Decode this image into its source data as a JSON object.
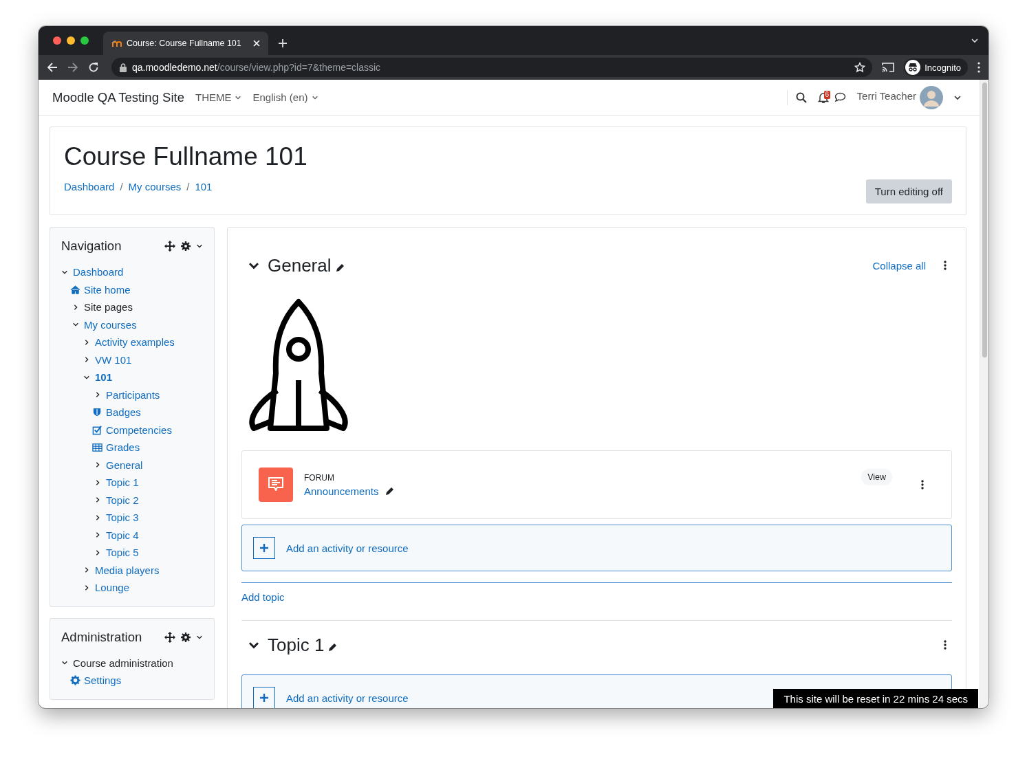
{
  "browser": {
    "tab_title": "Course: Course Fullname 101",
    "url_host": "qa.moodledemo.net",
    "url_path": "/course/view.php?id=7&theme=classic",
    "profile": "Incognito"
  },
  "navbar": {
    "site_name": "Moodle QA Testing Site",
    "menus": [
      "THEME",
      "English (en)"
    ],
    "notification_count": "6",
    "user_name": "Terri Teacher"
  },
  "header": {
    "title": "Course Fullname 101",
    "breadcrumbs": [
      {
        "label": "Dashboard",
        "kind": "link"
      },
      {
        "label": "/",
        "kind": "separator"
      },
      {
        "label": "My courses",
        "kind": "link"
      },
      {
        "label": "/",
        "kind": "separator"
      },
      {
        "label": "101",
        "kind": "link"
      }
    ],
    "edit_button": "Turn editing off"
  },
  "blocks": [
    {
      "title": "Navigation",
      "items": [
        {
          "label": "Dashboard",
          "kind": "branch",
          "expanded": true,
          "link": true,
          "current": false,
          "children": [
            {
              "label": "Site home",
              "kind": "home",
              "link": true,
              "current": false
            },
            {
              "label": "Site pages",
              "kind": "branch",
              "expanded": false,
              "link": false,
              "current": false
            },
            {
              "label": "My courses",
              "kind": "branch",
              "expanded": true,
              "link": true,
              "current": false,
              "children": [
                {
                  "label": "Activity examples",
                  "kind": "branch",
                  "expanded": false,
                  "link": true,
                  "current": false
                },
                {
                  "label": "VW 101",
                  "kind": "branch",
                  "expanded": false,
                  "link": true,
                  "current": false
                },
                {
                  "label": "101",
                  "kind": "branch",
                  "expanded": true,
                  "link": true,
                  "current": true,
                  "children": [
                    {
                      "label": "Participants",
                      "kind": "branch",
                      "expanded": false,
                      "link": true,
                      "current": false
                    },
                    {
                      "label": "Badges",
                      "kind": "shield",
                      "link": true,
                      "current": false
                    },
                    {
                      "label": "Competencies",
                      "kind": "checkbox",
                      "link": true,
                      "current": false
                    },
                    {
                      "label": "Grades",
                      "kind": "table",
                      "link": true,
                      "current": false
                    },
                    {
                      "label": "General",
                      "kind": "branch",
                      "expanded": false,
                      "link": true,
                      "current": false
                    },
                    {
                      "label": "Topic 1",
                      "kind": "branch",
                      "expanded": false,
                      "link": true,
                      "current": false
                    },
                    {
                      "label": "Topic 2",
                      "kind": "branch",
                      "expanded": false,
                      "link": true,
                      "current": false
                    },
                    {
                      "label": "Topic 3",
                      "kind": "branch",
                      "expanded": false,
                      "link": true,
                      "current": false
                    },
                    {
                      "label": "Topic 4",
                      "kind": "branch",
                      "expanded": false,
                      "link": true,
                      "current": false
                    },
                    {
                      "label": "Topic 5",
                      "kind": "branch",
                      "expanded": false,
                      "link": true,
                      "current": false
                    }
                  ]
                },
                {
                  "label": "Media players",
                  "kind": "branch",
                  "expanded": false,
                  "link": true,
                  "current": false
                },
                {
                  "label": "Lounge",
                  "kind": "branch",
                  "expanded": false,
                  "link": true,
                  "current": false
                }
              ]
            }
          ]
        }
      ]
    },
    {
      "title": "Administration",
      "items": [
        {
          "label": "Course administration",
          "kind": "branch",
          "expanded": true,
          "link": false,
          "current": false,
          "children": [
            {
              "label": "Settings",
              "kind": "gear",
              "link": true,
              "current": false
            }
          ]
        }
      ]
    }
  ],
  "course": {
    "collapse_all": "Collapse all",
    "sections": [
      {
        "title": "General",
        "expanded": true,
        "banner": {
          "kind": "rocket"
        },
        "activities": [
          {
            "type": "FORUM",
            "name": "Announcements",
            "action": "View"
          }
        ],
        "add_activity": "Add an activity or resource",
        "add_topic": "Add topic"
      },
      {
        "title": "Topic 1",
        "expanded": true,
        "add_activity": "Add an activity or resource"
      }
    ]
  },
  "notice": "This site will be reset in 22 mins 24 secs"
}
